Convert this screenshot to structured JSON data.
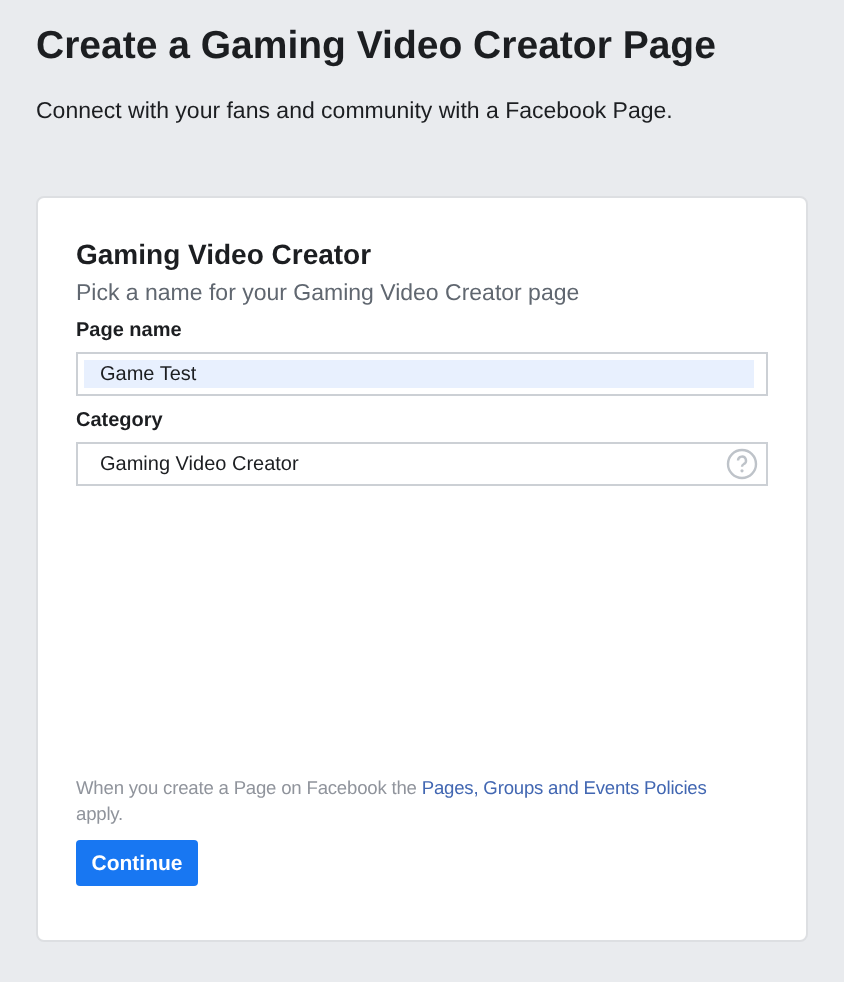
{
  "header": {
    "title": "Create a Gaming Video Creator Page",
    "subtitle": "Connect with your fans and community with a Facebook Page."
  },
  "card": {
    "title": "Gaming Video Creator",
    "hint": "Pick a name for your Gaming Video Creator page",
    "fields": [
      {
        "label": "Page name",
        "value": "Game Test",
        "autofilled": true,
        "kind": "text"
      },
      {
        "label": "Category",
        "value": "Gaming Video Creator",
        "autofilled": false,
        "kind": "help"
      }
    ],
    "policy": {
      "before": "When you create a Page on Facebook the ",
      "link": "Pages, Groups and Events Policies",
      "after": " apply."
    },
    "button": "Continue"
  }
}
